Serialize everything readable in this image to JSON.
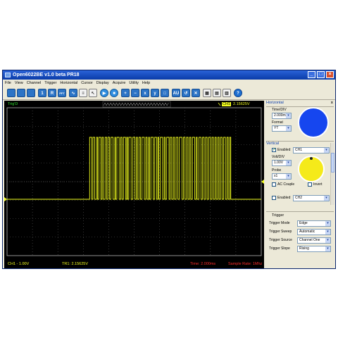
{
  "window": {
    "title": "Open6022BE v1.0 beta PR18"
  },
  "menu": [
    "File",
    "View",
    "Channel",
    "Trigger",
    "Horizontal",
    "Cursor",
    "Display",
    "Acquire",
    "Utility",
    "Help"
  ],
  "toolbar": {
    "buttons": [
      {
        "name": "open-icon",
        "style": "blue",
        "glyph": ""
      },
      {
        "name": "save-icon",
        "style": "blue",
        "glyph": ""
      },
      {
        "name": "print-icon",
        "style": "blue",
        "glyph": ""
      },
      {
        "name": "ch1-icon",
        "style": "blue",
        "glyph": "1"
      },
      {
        "name": "ref-icon",
        "style": "blue",
        "glyph": "R"
      },
      {
        "name": "fft-icon",
        "style": "blue",
        "glyph": "FFT"
      },
      {
        "name": "wave-icon",
        "style": "blue",
        "glyph": "∿"
      },
      {
        "name": "stack-icon",
        "style": "grey",
        "glyph": "≡"
      },
      {
        "name": "cursor-icon",
        "style": "grey",
        "glyph": "↖"
      },
      {
        "name": "run-icon",
        "style": "round",
        "glyph": "▶"
      },
      {
        "name": "stop-icon",
        "style": "round",
        "glyph": "■"
      },
      {
        "name": "zoom-in-icon",
        "style": "blue",
        "glyph": "+"
      },
      {
        "name": "zoom-out-icon",
        "style": "blue",
        "glyph": "−"
      },
      {
        "name": "zoom-x-icon",
        "style": "blue",
        "glyph": "x"
      },
      {
        "name": "zoom-y-icon",
        "style": "blue",
        "glyph": "y"
      },
      {
        "name": "zoom-fit-icon",
        "style": "blue",
        "glyph": "□"
      },
      {
        "name": "auto-icon",
        "style": "blue",
        "glyph": "AU"
      },
      {
        "name": "default-icon",
        "style": "blue",
        "glyph": "↺"
      },
      {
        "name": "fullscreen-icon",
        "style": "blue",
        "glyph": "✕"
      },
      {
        "name": "layout-icon",
        "style": "grey",
        "glyph": "▦"
      },
      {
        "name": "grid-icon",
        "style": "grey",
        "glyph": "▤"
      },
      {
        "name": "panel-icon",
        "style": "grey",
        "glyph": "▥"
      },
      {
        "name": "help-icon",
        "style": "help",
        "glyph": "?"
      }
    ]
  },
  "scope": {
    "trig_status": "Trig'D",
    "trigger_readout": "2.15625V",
    "trigger_channel": "CH1",
    "ch1_scale": "CH1 - 1.00V",
    "tr1": "TR1: 2.15625V",
    "time": "Time: 2.000ms",
    "sample_rate": "Sample Rate: 1Mhz",
    "colors": {
      "trace": "#f3ff1f",
      "grid": "#5a5a5a",
      "red": "#ff2e2e",
      "frame": "#8f8f8f"
    },
    "signal_bursts": [
      [
        0.325,
        0.333
      ],
      [
        0.338,
        0.345
      ],
      [
        0.352,
        0.356
      ],
      [
        0.361,
        0.369
      ],
      [
        0.374,
        0.379
      ],
      [
        0.386,
        0.392
      ],
      [
        0.397,
        0.403
      ],
      [
        0.409,
        0.417
      ],
      [
        0.424,
        0.427
      ],
      [
        0.432,
        0.441
      ],
      [
        0.447,
        0.452
      ],
      [
        0.458,
        0.466
      ],
      [
        0.471,
        0.474
      ],
      [
        0.479,
        0.488
      ],
      [
        0.495,
        0.503
      ],
      [
        0.509,
        0.513
      ],
      [
        0.519,
        0.525
      ],
      [
        0.531,
        0.54
      ],
      [
        0.546,
        0.551
      ],
      [
        0.557,
        0.56
      ],
      [
        0.566,
        0.575
      ],
      [
        0.581,
        0.588
      ],
      [
        0.593,
        0.597
      ],
      [
        0.603,
        0.612
      ],
      [
        0.618,
        0.622
      ],
      [
        0.628,
        0.637
      ],
      [
        0.642,
        0.648
      ],
      [
        0.654,
        0.659
      ],
      [
        0.665,
        0.672
      ],
      [
        0.678,
        0.688
      ],
      [
        0.694,
        0.7
      ],
      [
        0.706,
        0.712
      ],
      [
        0.718,
        0.723
      ],
      [
        0.729,
        0.738
      ],
      [
        0.744,
        0.748
      ],
      [
        0.755,
        0.763
      ],
      [
        0.769,
        0.775
      ],
      [
        0.781,
        0.787
      ],
      [
        0.793,
        0.8
      ],
      [
        0.806,
        0.812
      ],
      [
        0.818,
        0.823
      ],
      [
        0.829,
        0.834
      ],
      [
        0.84,
        0.846
      ],
      [
        0.852,
        0.859
      ],
      [
        0.865,
        0.87
      ],
      [
        0.876,
        0.88
      ]
    ]
  },
  "panel": {
    "horizontal": {
      "title": "Horizontal",
      "time_div_label": "Time/DIV",
      "time_div_value": "2.000ms",
      "format_label": "Format",
      "format_value": "YT",
      "knob_color": "#1646ef"
    },
    "vertical": {
      "title": "Vertical",
      "enabled_label": "Enabled",
      "channel_value": "CH1",
      "volt_div_label": "Volt/DIV",
      "volt_div_value": "1.00V",
      "probe_label": "Probe",
      "probe_value": "x1",
      "ac_couple_label": "AC Couple",
      "invert_label": "Invert",
      "enabled2_label": "Enabled",
      "channel2_value": "CH2",
      "knob_color": "#f5ea1a"
    },
    "trigger": {
      "title": "Trigger",
      "mode_label": "Trigger Mode",
      "mode_value": "Edge",
      "sweep_label": "Trigger Sweep",
      "sweep_value": "Automatic",
      "source_label": "Trigger Source",
      "source_value": "Channel One",
      "slope_label": "Trigger Slope",
      "slope_value": "Rising"
    }
  }
}
